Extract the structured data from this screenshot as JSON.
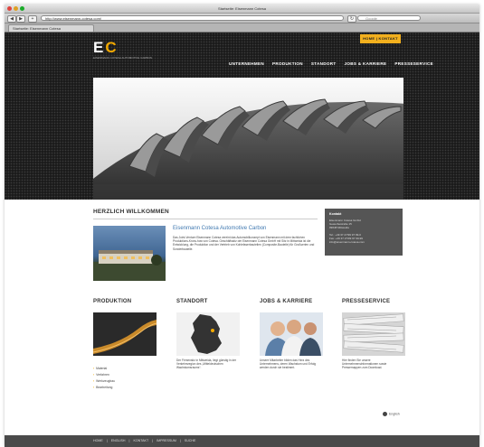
{
  "browser": {
    "window_title": "Startseite: Eisenmann Cotesa",
    "url": "http://www.eisenmann-cotesa.com/",
    "search_placeholder": "Google",
    "tab_label": "Startseite: Eisenmann Cotesa"
  },
  "header": {
    "logo_text_left": "E",
    "logo_text_right": "C",
    "logo_subtitle": "EISENMANN COTESA AUTOMOTIVE CARBON",
    "contact_button": "HOME | KONTAKT",
    "nav": [
      "UNTERNEHMEN",
      "PRODUKTION",
      "STANDORT",
      "JOBS & KARRIERE",
      "PRESSESERVICE"
    ]
  },
  "welcome": {
    "heading": "HERZLICH WILLKOMMEN",
    "subheading": "Eisenmann Cotesa Automotive Carbon",
    "body": "Das Joint-Venture Eisenmann Cotesa vereint das Automobilkonzept von Eisenmann mit dem fachlichen Produktions-Know-how von Cotesa. Geschäftssitz der Eisenmann Cotesa GmbH mit Sitz in Mittweida ist die Entwicklung, die Produktion und der Vertrieb von Kohlefaserbauteilen (Composite-Bauteile) für Großserien und Sonderbauteile."
  },
  "infobox": {
    "title": "Kontakt",
    "lines": [
      "Eisenmann Cotesa GmbH",
      "Gewerbestraße 15",
      "09648 Mittweida",
      "Tel.: +49 37 27/99 97 99-0",
      "Fax: +49 37 27/99 97 99-99",
      "info@eisenmann-cotesa.com"
    ]
  },
  "columns": [
    {
      "title": "PRODUKTION",
      "links": [
        "Material",
        "Verfahren",
        "Werkzeugbau",
        "Bearbeitung"
      ],
      "text": ""
    },
    {
      "title": "STANDORT",
      "links": [],
      "text": "Der Firmensitz in Mittweida, liegt günstig in der Verkehrsregion des „Mitteldeutschen Wachstumsraums“."
    },
    {
      "title": "JOBS & KARRIERE",
      "links": [],
      "text": "Unsere Mitarbeiter bilden das Herz des Unternehmens, deren Wachstum und Erfolg werden durch sie bestimmt."
    },
    {
      "title": "PRESSESERVICE",
      "links": [],
      "text": "Hier finden Sie unsere Unternehmensinformationen sowie Pressemappen zum Download."
    }
  ],
  "language_button": "English",
  "footer": {
    "links": [
      "HOME",
      "ENGLISH",
      "KONTAKT",
      "IMPRESSUM",
      "SUCHE"
    ],
    "separator": "|"
  }
}
